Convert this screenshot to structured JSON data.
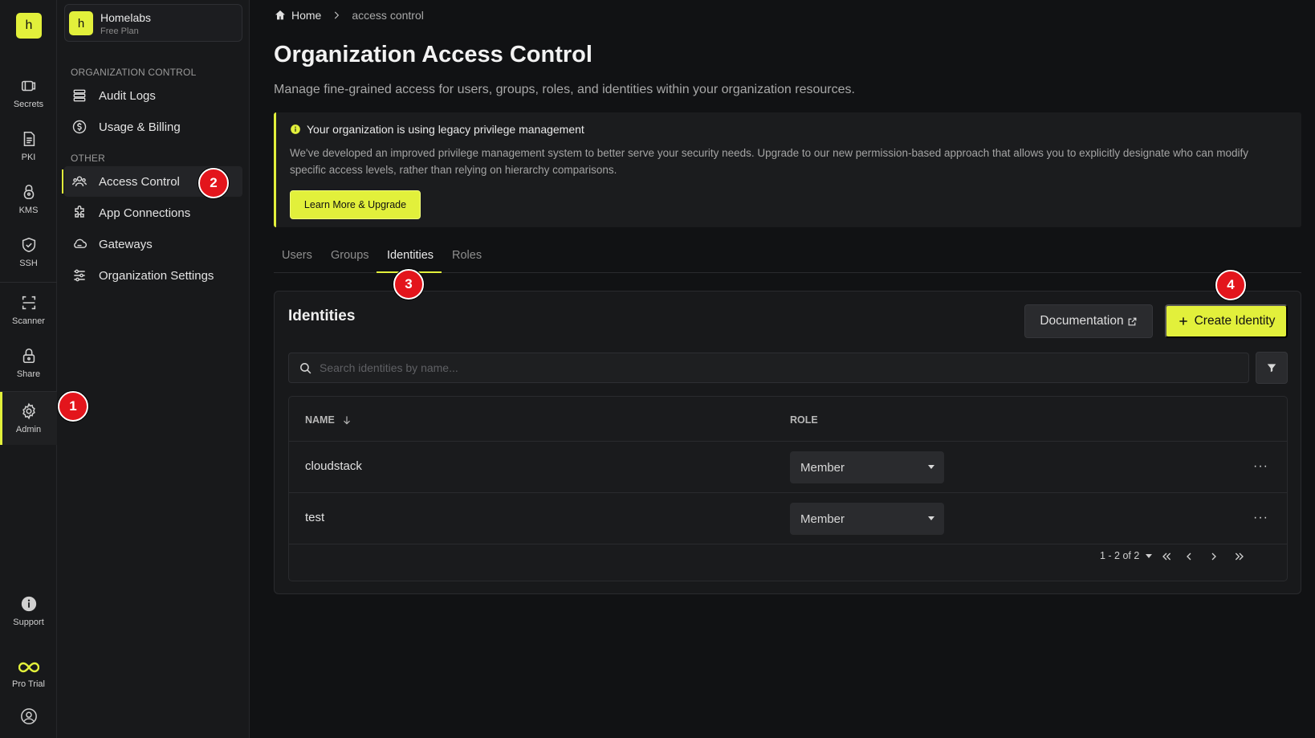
{
  "rail": {
    "logo_letter": "h",
    "items": [
      {
        "label": "Secrets",
        "icon": "secrets-icon"
      },
      {
        "label": "PKI",
        "icon": "pki-icon"
      },
      {
        "label": "KMS",
        "icon": "kms-icon"
      },
      {
        "label": "SSH",
        "icon": "ssh-shield-icon"
      },
      {
        "label": "Scanner",
        "icon": "scanner-icon"
      },
      {
        "label": "Share",
        "icon": "lock-icon"
      },
      {
        "label": "Admin",
        "icon": "gear-icon"
      }
    ],
    "bottom": [
      {
        "label": "Support",
        "icon": "info-icon"
      },
      {
        "label": "Pro Trial",
        "icon": "infinity-icon"
      }
    ],
    "accent": "#e2f03b"
  },
  "org": {
    "avatar_letter": "h",
    "name": "Homelabs",
    "plan": "Free Plan"
  },
  "sidebar": {
    "sections": [
      {
        "label": "ORGANIZATION CONTROL",
        "items": [
          {
            "label": "Audit Logs",
            "icon": "list-icon"
          },
          {
            "label": "Usage & Billing",
            "icon": "dollar-circle-icon"
          }
        ]
      },
      {
        "label": "OTHER",
        "items": [
          {
            "label": "Access Control",
            "icon": "users-icon"
          },
          {
            "label": "App Connections",
            "icon": "puzzle-icon"
          },
          {
            "label": "Gateways",
            "icon": "cloud-icon"
          },
          {
            "label": "Organization Settings",
            "icon": "sliders-icon"
          }
        ]
      }
    ]
  },
  "breadcrumb": {
    "home": "Home",
    "current": "access control"
  },
  "page": {
    "title": "Organization Access Control",
    "description": "Manage fine-grained access for users, groups, roles, and identities within your organization resources."
  },
  "banner": {
    "title": "Your organization is using legacy privilege management",
    "text": "We've developed an improved privilege management system to better serve your security needs. Upgrade to our new permission-based approach that allows you to explicitly designate who can modify specific access levels, rather than relying on hierarchy comparisons.",
    "button": "Learn More & Upgrade"
  },
  "tabs": [
    {
      "label": "Users",
      "active": false
    },
    {
      "label": "Groups",
      "active": false
    },
    {
      "label": "Identities",
      "active": true
    },
    {
      "label": "Roles",
      "active": false
    }
  ],
  "identities": {
    "title": "Identities",
    "doc_button": "Documentation",
    "create_button": "Create Identity",
    "search_placeholder": "Search identities by name...",
    "columns": {
      "name": "NAME",
      "role": "ROLE"
    },
    "rows": [
      {
        "name": "cloudstack",
        "role": "Member"
      },
      {
        "name": "test",
        "role": "Member"
      }
    ],
    "pagination": "1 - 2 of 2"
  },
  "markers": [
    "1",
    "2",
    "3",
    "4"
  ]
}
